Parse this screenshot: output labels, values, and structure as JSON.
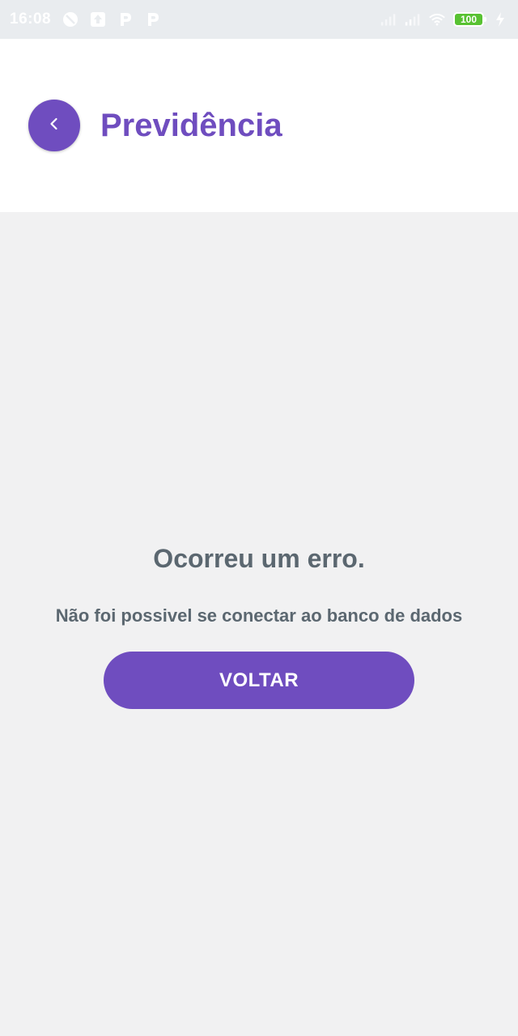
{
  "status_bar": {
    "time": "16:08",
    "battery_level": "100",
    "icons": [
      "do-not-disturb-icon",
      "upload-icon",
      "parking-p-icon",
      "parking-p-icon",
      "signal-icon",
      "signal-icon",
      "wifi-icon",
      "battery-icon",
      "charging-icon"
    ]
  },
  "header": {
    "title": "Previdência"
  },
  "error": {
    "title": "Ocorreu um erro.",
    "message": "Não foi possivel se conectar ao banco de dados",
    "button_label": "VOLTAR"
  },
  "colors": {
    "primary": "#6f4dbf",
    "text_muted": "#5b6770",
    "background": "#f1f1f2",
    "battery": "#58c232"
  }
}
